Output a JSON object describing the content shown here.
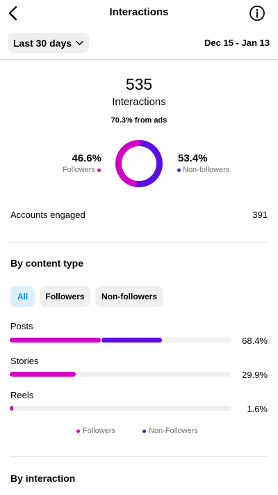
{
  "header": {
    "title": "Interactions",
    "back_icon": "chevron-left-icon",
    "info_icon": "info-circle-icon"
  },
  "filter": {
    "range_label": "Last 30 days",
    "date_range": "Dec 15 - Jan 13"
  },
  "summary": {
    "total": "535",
    "total_label": "Interactions",
    "ads_note": "70.3% from ads",
    "followers_pct": "46.6%",
    "followers_label": "Followers",
    "nonfollowers_pct": "53.4%",
    "nonfollowers_label": "Non-followers",
    "followers_share": 0.466
  },
  "accounts_engaged": {
    "label": "Accounts engaged",
    "value": "391"
  },
  "content_type": {
    "title": "By content type",
    "chips": [
      "All",
      "Followers",
      "Non-followers"
    ],
    "selected_chip": "All",
    "rows": [
      {
        "label": "Posts",
        "pct": "68.4%",
        "followers_fraction": 0.41,
        "nonfollowers_fraction": 0.274
      },
      {
        "label": "Stories",
        "pct": "29.9%",
        "followers_fraction": 0.299,
        "nonfollowers_fraction": 0
      },
      {
        "label": "Reels",
        "pct": "1.6%",
        "followers_fraction": 0.016,
        "nonfollowers_fraction": 0
      }
    ],
    "legend": {
      "followers": "Followers",
      "nonfollowers": "Non-Followers"
    }
  },
  "by_interaction": {
    "title": "By interaction"
  },
  "colors": {
    "followers": "#d300c5",
    "nonfollowers": "#5b0fe0",
    "chip_active_bg": "#ddeefb",
    "chip_active_text": "#0095f6"
  }
}
